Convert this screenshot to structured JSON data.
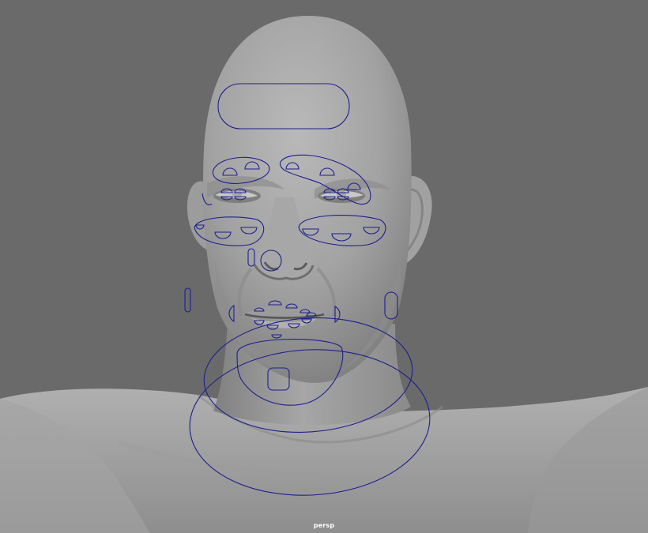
{
  "viewport": {
    "camera_label": "persp",
    "background_color": "#6a6a6a",
    "curve_color": "#1f1f8f",
    "model": "male-head-bust"
  },
  "controls": [
    "forehead-control",
    "brow-control-left",
    "brow-control-right",
    "eye-control-left",
    "eye-control-right",
    "cheek-control-left",
    "cheek-control-right",
    "nose-left-control",
    "nose-control",
    "mouth-corner-left-control",
    "mouth-corner-right-control",
    "lip-upper-control",
    "lip-lower-control",
    "cheek-lower-left-control",
    "cheek-lower-right-control",
    "jaw-control",
    "chin-control",
    "neck-control",
    "head-control"
  ]
}
